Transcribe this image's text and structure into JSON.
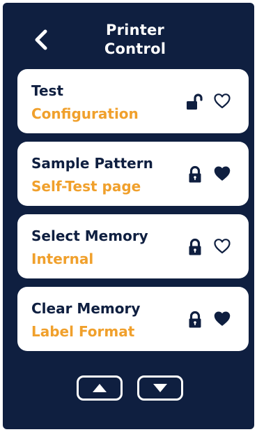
{
  "header": {
    "title_line1": "Printer",
    "title_line2": "Control",
    "back_icon": "chevron-left-icon"
  },
  "items": [
    {
      "title": "Test",
      "subtitle": "Configuration",
      "locked": false,
      "favorite": false,
      "lock_icon": "lock-open-icon",
      "heart_icon": "heart-outline-icon"
    },
    {
      "title": "Sample Pattern",
      "subtitle": "Self-Test page",
      "locked": true,
      "favorite": true,
      "lock_icon": "lock-closed-icon",
      "heart_icon": "heart-filled-icon"
    },
    {
      "title": "Select Memory",
      "subtitle": "Internal",
      "locked": true,
      "favorite": false,
      "lock_icon": "lock-closed-icon",
      "heart_icon": "heart-outline-icon"
    },
    {
      "title": "Clear Memory",
      "subtitle": "Label Format",
      "locked": true,
      "favorite": true,
      "lock_icon": "lock-closed-icon",
      "heart_icon": "heart-filled-icon"
    }
  ],
  "pager": {
    "up_icon": "triangle-up-icon",
    "down_icon": "triangle-down-icon"
  },
  "colors": {
    "background": "#0f1f40",
    "card": "#ffffff",
    "title_text": "#0f1f40",
    "subtitle_text": "#f0a02c"
  }
}
